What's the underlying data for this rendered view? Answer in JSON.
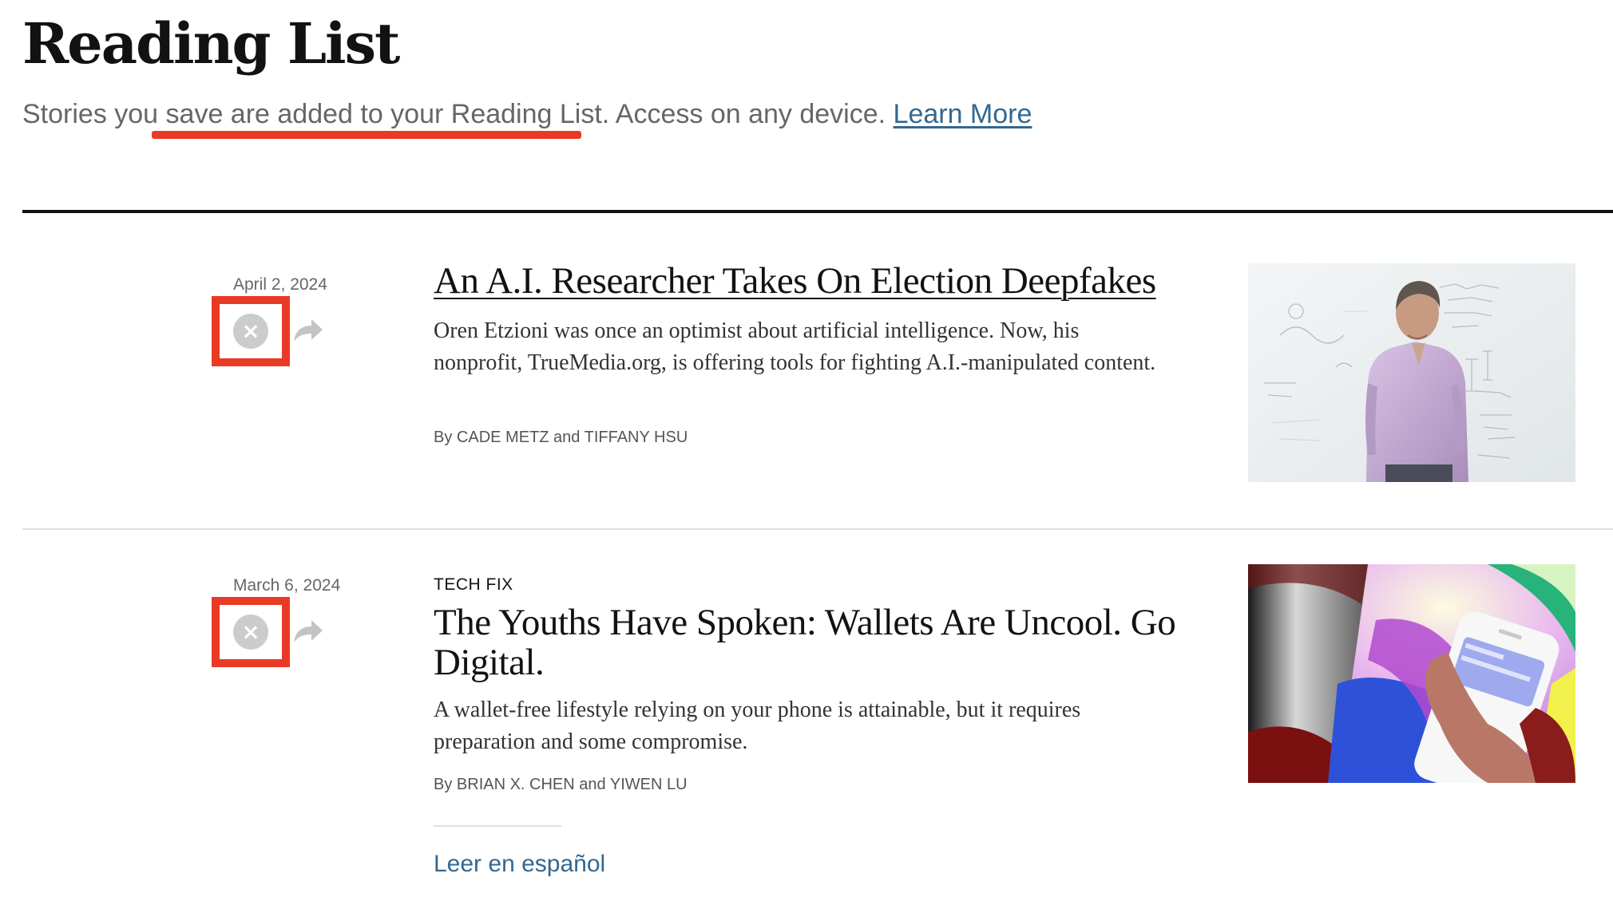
{
  "page": {
    "title": "Reading List",
    "intro_prefix": "Stories you save are added to your Reading List. Access on any device.",
    "learn_more": "Learn More"
  },
  "articles": [
    {
      "date": "April 2, 2024",
      "kicker": "",
      "headline": "An A.I. Researcher Takes On Election Deepfakes",
      "summary": "Oren Etzioni was once an optimist about artificial intelligence. Now, his nonprofit, TrueMedia.org, is offering tools for fighting A.I.-manipulated content.",
      "byline_prefix": "By",
      "author_1": "Cade Metz",
      "byline_and": "and",
      "author_2": "Tiffany Hsu",
      "remove_icon": "close-circle-icon",
      "share_icon": "share-arrow-icon",
      "thumbnail": "man-at-whiteboard-photo"
    },
    {
      "date": "March 6, 2024",
      "kicker": "TECH FIX",
      "headline": "The Youths Have Spoken: Wallets Are Uncool. Go Digital.",
      "summary": "A wallet-free lifestyle relying on your phone is attainable, but it requires preparation and some compromise.",
      "byline_prefix": "By",
      "author_1": "Brian X. Chen",
      "byline_and": "and",
      "author_2": "Yiwen Lu",
      "remove_icon": "close-circle-icon",
      "share_icon": "share-arrow-icon",
      "thumbnail": "phone-wallet-illustration",
      "translation_link": "Leer en español"
    }
  ],
  "colors": {
    "annotation_red": "#ea3a26",
    "link_blue": "#326891",
    "text_dark": "#121212",
    "text_gray": "#666666"
  }
}
